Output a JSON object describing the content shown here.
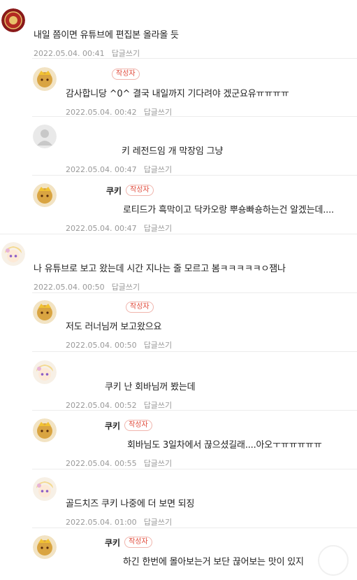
{
  "colors": {
    "author_badge": "#e04a3a",
    "meta_text": "#999999",
    "separator": "#ececec"
  },
  "comments": [
    {
      "type": "top",
      "avatar": "emblem-avatar",
      "nick": "",
      "is_author": false,
      "text": "내일 쯤이면 유튜브에 편집본 올라올 듯",
      "date": "2022.05.04. 00:41",
      "reply_label": "답글쓰기"
    },
    {
      "type": "reply",
      "avatar": "cookie-crown-avatar",
      "nick": "",
      "is_author": true,
      "author_label": "작성자",
      "text": "감사합니당 ^0^ 결국 내일까지 기다려야 겠군요유ㅠㅠㅠㅠ",
      "date": "2022.05.04. 00:42",
      "reply_label": "답글쓰기"
    },
    {
      "type": "reply",
      "avatar": "default-user-avatar",
      "nick": "",
      "is_author": false,
      "text": "키 레전드임 개 막장임 그냥",
      "date": "2022.05.04. 00:47",
      "reply_label": "답글쓰기"
    },
    {
      "type": "reply",
      "avatar": "cookie-crown-avatar",
      "nick": "쿠키",
      "is_author": true,
      "author_label": "작성자",
      "text": "로티드가 흑막이고 닥카오랑 뿌숑빠숑하는건 알겠는데....",
      "date": "2022.05.04. 00:47",
      "reply_label": "답글쓰기"
    },
    {
      "type": "top",
      "avatar": "cookie-girl-avatar",
      "nick": "",
      "is_author": false,
      "text": "나 유튜브로 보고 왔는데 시간 지나는 줄 모르고 봄ㅋㅋㅋㅋㅋㅇ잼나",
      "date": "2022.05.04. 00:50",
      "reply_label": "답글쓰기"
    },
    {
      "type": "reply",
      "avatar": "cookie-crown-avatar",
      "nick": "",
      "is_author": true,
      "author_label": "작성자",
      "text": "저도 러너님꺼 보고왔으요",
      "date": "2022.05.04. 00:50",
      "reply_label": "답글쓰기"
    },
    {
      "type": "reply",
      "avatar": "cookie-girl-avatar",
      "nick": "",
      "is_author": false,
      "text": "쿠키 난 회바님꺼 봤는데",
      "date": "2022.05.04. 00:52",
      "reply_label": "답글쓰기"
    },
    {
      "type": "reply",
      "avatar": "cookie-crown-avatar",
      "nick": "쿠키",
      "is_author": true,
      "author_label": "작성자",
      "text": "회바님도 3일차에서 끊으셨길래....아오ㅜㅠㅠㅠㅠㅠ",
      "date": "2022.05.04. 00:55",
      "reply_label": "답글쓰기"
    },
    {
      "type": "reply",
      "avatar": "cookie-girl-avatar",
      "nick": "",
      "is_author": false,
      "text": "골드치즈 쿠키 나중에 더 보면 되징",
      "date": "2022.05.04. 01:00",
      "reply_label": "답글쓰기"
    },
    {
      "type": "reply",
      "avatar": "cookie-crown-avatar",
      "nick": "쿠키",
      "is_author": true,
      "author_label": "작성자",
      "text": "하긴 한번에 몰아보는거 보단 끊어보는 맛이 있지",
      "date": "",
      "reply_label": ""
    }
  ]
}
